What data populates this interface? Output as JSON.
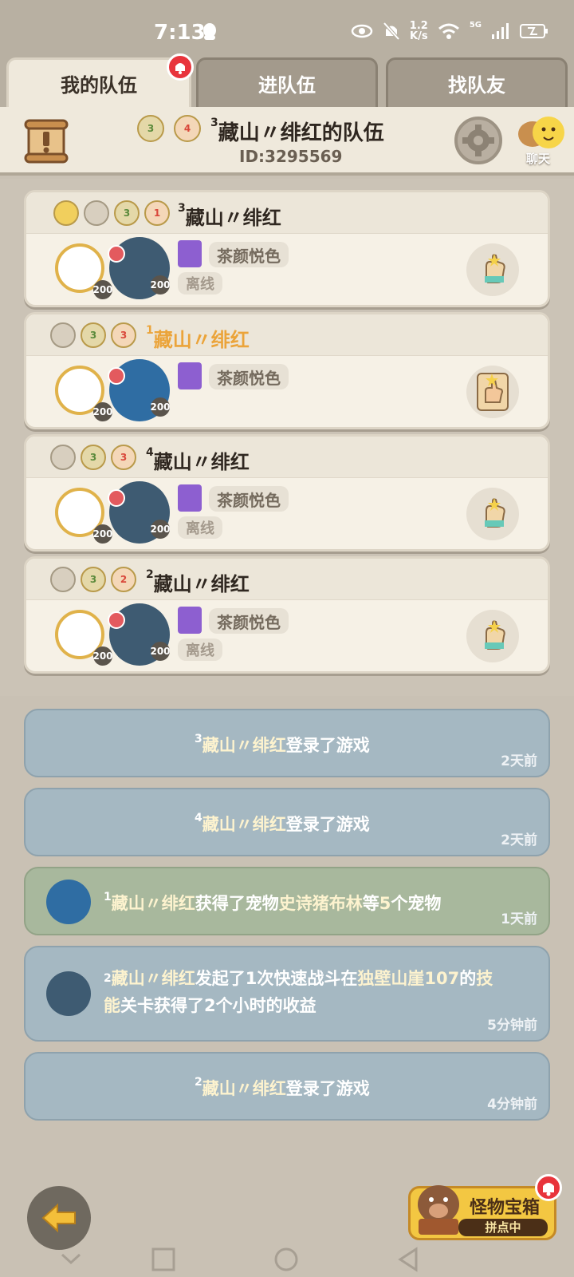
{
  "status_bar": {
    "time": "7:13",
    "net_speed_value": "1.2",
    "net_speed_unit": "K/s",
    "signal_label": "5G"
  },
  "tabs": [
    {
      "label": "我的队伍",
      "active": true
    },
    {
      "label": "进队伍",
      "active": false
    },
    {
      "label": "找队友",
      "active": false
    }
  ],
  "team": {
    "title_sup": "3",
    "title": "藏山〃绯红的队伍",
    "id_label": "ID:3295569",
    "header_badge_1": "3",
    "header_badge_2": "4",
    "chat_label": "聊天"
  },
  "members": [
    {
      "sup": "3",
      "name": "藏山〃绯红",
      "highlight": false,
      "guild": "茶颜悦色",
      "status": "离线",
      "level_1": "200",
      "level_2": "200",
      "badges": [
        "",
        "",
        "3",
        "1"
      ]
    },
    {
      "sup": "1",
      "name": "藏山〃绯红",
      "highlight": true,
      "guild": "茶颜悦色",
      "status": "",
      "level_1": "200",
      "level_2": "200",
      "badges": [
        "",
        "3",
        "3"
      ]
    },
    {
      "sup": "4",
      "name": "藏山〃绯红",
      "highlight": false,
      "guild": "茶颜悦色",
      "status": "离线",
      "level_1": "200",
      "level_2": "200",
      "badges": [
        "",
        "3",
        "3"
      ]
    },
    {
      "sup": "2",
      "name": "藏山〃绯红",
      "highlight": false,
      "guild": "茶颜悦色",
      "status": "离线",
      "level_1": "200",
      "level_2": "200",
      "badges": [
        "",
        "3",
        "2"
      ]
    }
  ],
  "feed": [
    {
      "sup": "3",
      "name": "藏山〃绯红",
      "text": "登录了游戏",
      "time": "2天前"
    },
    {
      "sup": "4",
      "name": "藏山〃绯红",
      "text": "登录了游戏",
      "time": "2天前"
    },
    {
      "sup": "1",
      "name": "藏山〃绯红",
      "text_1": "获得了宠物",
      "pet": "史诗猪布林",
      "text_2": "等",
      "count": "5",
      "text_3": "个宠物",
      "time": "1天前"
    },
    {
      "sup": "2",
      "name": "藏山〃绯红",
      "text_1": "发起了1次快速战斗在",
      "place": "独壁山崖107",
      "text_2": "的",
      "hl_3": "技",
      "line2_hl": "能",
      "text_3": "关卡获得了2个小时的收益",
      "time": "5分钟前"
    },
    {
      "sup": "2",
      "name": "藏山〃绯红",
      "text": "登录了游戏",
      "time": "4分钟前"
    }
  ],
  "treasure": {
    "title": "怪物宝箱",
    "subtitle": "拼点中"
  },
  "colors": {
    "accent_orange": "#eba43a",
    "feed_blue": "#a5b8c2",
    "feed_green": "#a8b89d",
    "badge_red": "#e8343c"
  }
}
